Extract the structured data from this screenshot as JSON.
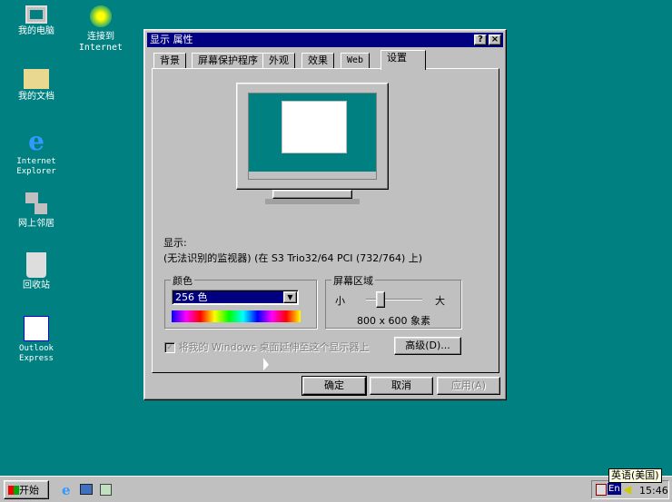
{
  "desktop": {
    "icons": [
      {
        "label": "我的电脑"
      },
      {
        "label": "连接到 Internet"
      },
      {
        "label": "我的文档"
      },
      {
        "label": "Internet Explorer"
      },
      {
        "label": "网上邻居"
      },
      {
        "label": "回收站"
      },
      {
        "label": "Outlook Express"
      }
    ]
  },
  "dialog": {
    "title": "显示 属性",
    "help": "?",
    "close": "×",
    "tabs": [
      "背景",
      "屏幕保护程序",
      "外观",
      "效果",
      "Web",
      "设置"
    ],
    "display_label": "显示:",
    "display_value": "(无法识别的监视器) (在 S3 Trio32/64 PCI (732/764) 上)",
    "colors": {
      "label": "颜色",
      "selected": "256 色"
    },
    "screen_area": {
      "label": "屏幕区域",
      "small": "小",
      "large": "大",
      "value": "800 x 600 象素",
      "slider_fraction": 0.25
    },
    "extend_checkbox": {
      "label": "将我的 Windows 桌面延伸至这个显示器上",
      "checked": true,
      "disabled": true
    },
    "advanced": "高级(D)...",
    "ok": "确定",
    "cancel": "取消",
    "apply": "应用(A)"
  },
  "taskbar": {
    "start": "开始",
    "clock": "15:46",
    "lang": "En",
    "tooltip": "英语(美国)"
  }
}
